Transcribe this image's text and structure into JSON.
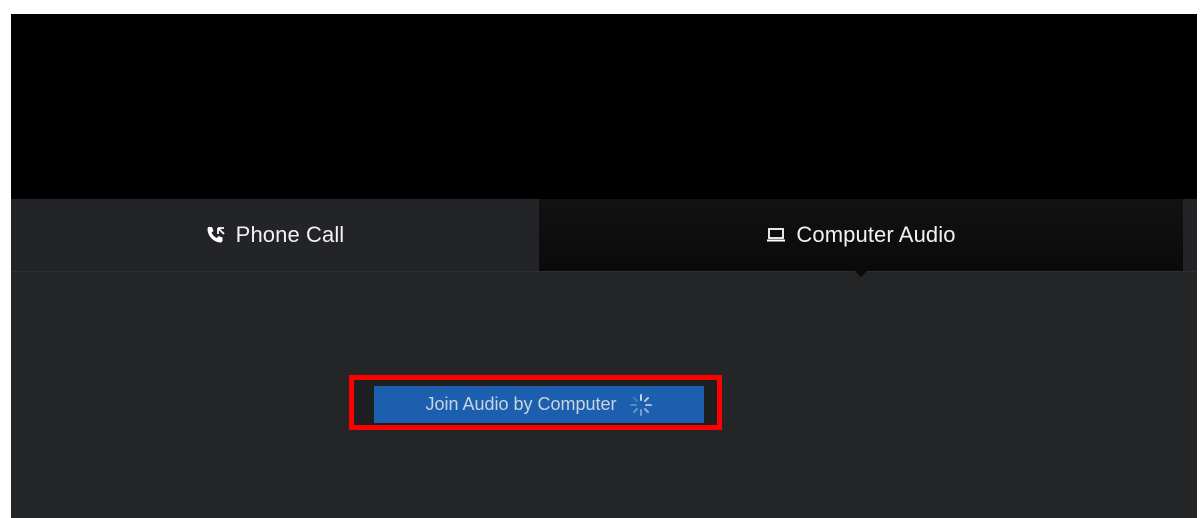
{
  "tabs": {
    "phone": {
      "label": "Phone Call",
      "icon": "phone-icon"
    },
    "computer": {
      "label": "Computer Audio",
      "icon": "laptop-icon"
    }
  },
  "join": {
    "label": "Join Audio by Computer",
    "loading_icon": "spinner-icon",
    "button_color": "#1c5fae",
    "highlight_color": "#ff0000"
  }
}
